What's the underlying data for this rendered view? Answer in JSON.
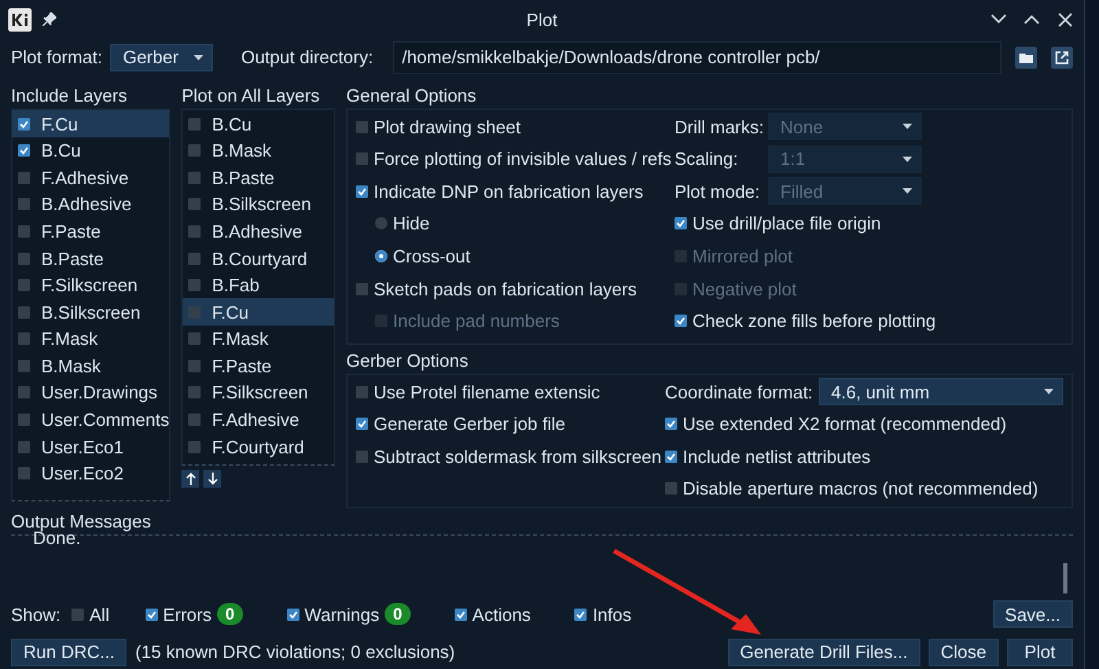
{
  "window": {
    "title": "Plot"
  },
  "plot_format": {
    "label": "Plot format:",
    "value": "Gerber"
  },
  "output_directory": {
    "label": "Output directory:",
    "value": "/home/smikkelbakje/Downloads/drone controller pcb/"
  },
  "include_layers": {
    "title": "Include Layers",
    "items": [
      {
        "label": "F.Cu",
        "checked": true,
        "selected": true
      },
      {
        "label": "B.Cu",
        "checked": true,
        "selected": false
      },
      {
        "label": "F.Adhesive",
        "checked": false,
        "selected": false
      },
      {
        "label": "B.Adhesive",
        "checked": false,
        "selected": false
      },
      {
        "label": "F.Paste",
        "checked": false,
        "selected": false
      },
      {
        "label": "B.Paste",
        "checked": false,
        "selected": false
      },
      {
        "label": "F.Silkscreen",
        "checked": false,
        "selected": false
      },
      {
        "label": "B.Silkscreen",
        "checked": false,
        "selected": false
      },
      {
        "label": "F.Mask",
        "checked": false,
        "selected": false
      },
      {
        "label": "B.Mask",
        "checked": false,
        "selected": false
      },
      {
        "label": "User.Drawings",
        "checked": false,
        "selected": false
      },
      {
        "label": "User.Comments",
        "checked": false,
        "selected": false
      },
      {
        "label": "User.Eco1",
        "checked": false,
        "selected": false
      },
      {
        "label": "User.Eco2",
        "checked": false,
        "selected": false
      }
    ]
  },
  "plot_on_all_layers": {
    "title": "Plot on All Layers",
    "items": [
      {
        "label": "B.Cu",
        "checked": false,
        "selected": false
      },
      {
        "label": "B.Mask",
        "checked": false,
        "selected": false
      },
      {
        "label": "B.Paste",
        "checked": false,
        "selected": false
      },
      {
        "label": "B.Silkscreen",
        "checked": false,
        "selected": false
      },
      {
        "label": "B.Adhesive",
        "checked": false,
        "selected": false
      },
      {
        "label": "B.Courtyard",
        "checked": false,
        "selected": false
      },
      {
        "label": "B.Fab",
        "checked": false,
        "selected": false
      },
      {
        "label": "F.Cu",
        "checked": false,
        "selected": true
      },
      {
        "label": "F.Mask",
        "checked": false,
        "selected": false
      },
      {
        "label": "F.Paste",
        "checked": false,
        "selected": false
      },
      {
        "label": "F.Silkscreen",
        "checked": false,
        "selected": false
      },
      {
        "label": "F.Adhesive",
        "checked": false,
        "selected": false
      },
      {
        "label": "F.Courtyard",
        "checked": false,
        "selected": false
      }
    ]
  },
  "general_options": {
    "title": "General Options",
    "left": [
      {
        "kind": "checkbox",
        "label": "Plot drawing sheet",
        "checked": false,
        "disabled": false
      },
      {
        "kind": "checkbox",
        "label": "Force plotting of invisible values / refs",
        "checked": false,
        "disabled": false
      },
      {
        "kind": "checkbox",
        "label": "Indicate DNP on fabrication layers",
        "checked": true,
        "disabled": false,
        "children": [
          {
            "kind": "radio",
            "label": "Hide",
            "selected": false,
            "disabled": false
          },
          {
            "kind": "radio",
            "label": "Cross-out",
            "selected": true,
            "disabled": false
          }
        ]
      },
      {
        "kind": "checkbox",
        "label": "Sketch pads on fabrication layers",
        "checked": false,
        "disabled": false,
        "children": [
          {
            "kind": "checkbox",
            "label": "Include pad numbers",
            "checked": false,
            "disabled": true
          }
        ]
      }
    ],
    "right": [
      {
        "kind": "select",
        "label": "Drill marks:",
        "value": "None",
        "disabled": true
      },
      {
        "kind": "select",
        "label": "Scaling:",
        "value": "1:1",
        "disabled": true
      },
      {
        "kind": "select",
        "label": "Plot mode:",
        "value": "Filled",
        "disabled": true
      },
      {
        "kind": "checkbox",
        "label": "Use drill/place file origin",
        "checked": true,
        "disabled": false
      },
      {
        "kind": "checkbox",
        "label": "Mirrored plot",
        "checked": false,
        "disabled": true
      },
      {
        "kind": "checkbox",
        "label": "Negative plot",
        "checked": false,
        "disabled": true
      },
      {
        "kind": "checkbox",
        "label": "Check zone fills before plotting",
        "checked": true,
        "disabled": false
      }
    ]
  },
  "gerber_options": {
    "title": "Gerber Options",
    "left": [
      {
        "kind": "checkbox",
        "label": "Use Protel filename extensic",
        "checked": false,
        "disabled": false
      },
      {
        "kind": "checkbox",
        "label": "Generate Gerber job file",
        "checked": true,
        "disabled": false
      },
      {
        "kind": "checkbox",
        "label": "Subtract soldermask from silkscreen",
        "checked": false,
        "disabled": false
      }
    ],
    "right": [
      {
        "kind": "select",
        "label": "Coordinate format:",
        "value": "4.6, unit mm",
        "disabled": false
      },
      {
        "kind": "checkbox",
        "label": "Use extended X2 format (recommended)",
        "checked": true,
        "disabled": false
      },
      {
        "kind": "checkbox",
        "label": "Include netlist attributes",
        "checked": true,
        "disabled": false
      },
      {
        "kind": "checkbox",
        "label": "Disable aperture macros (not recommended)",
        "checked": false,
        "disabled": false
      }
    ]
  },
  "output_messages": {
    "title": "Output Messages",
    "text": "Done.",
    "show_label": "Show:",
    "filters": [
      {
        "label": "All",
        "checked": false
      },
      {
        "label": "Errors",
        "checked": true,
        "count": "0"
      },
      {
        "label": "Warnings",
        "checked": true,
        "count": "0"
      },
      {
        "label": "Actions",
        "checked": true
      },
      {
        "label": "Infos",
        "checked": true
      }
    ],
    "save_button": "Save..."
  },
  "footer": {
    "run_drc": "Run DRC...",
    "drc_status": "(15 known DRC violations; 0 exclusions)",
    "buttons": [
      "Generate Drill Files...",
      "Close",
      "Plot"
    ]
  }
}
